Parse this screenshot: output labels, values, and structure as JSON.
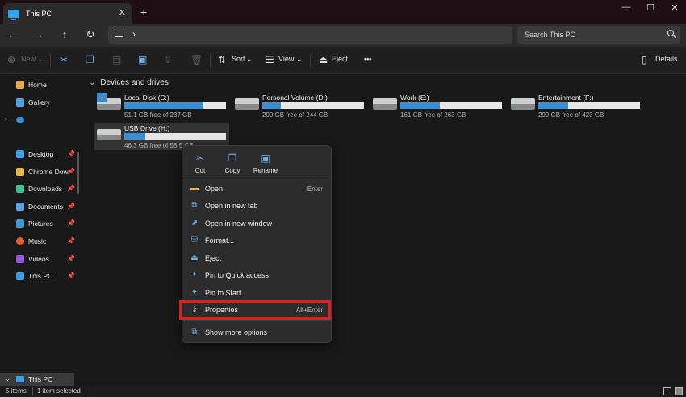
{
  "window": {
    "tab_title": "This PC",
    "new_tab": "+",
    "close_tab": "✕",
    "controls": {
      "minimize": "—",
      "maximize": "☐",
      "close": "✕"
    }
  },
  "address": {
    "search_placeholder": "Search This PC",
    "chevron": "›"
  },
  "nav": {
    "back": "←",
    "forward": "→",
    "up": "↑",
    "refresh": "↻"
  },
  "toolbar": {
    "new_label": "New",
    "sort_label": "Sort",
    "view_label": "View",
    "eject_label": "Eject",
    "more": "•••",
    "details_label": "Details"
  },
  "sidebar": {
    "items": [
      {
        "label": "Home",
        "icon": "home-icon",
        "color": "#e8a54a",
        "pinned": false
      },
      {
        "label": "Gallery",
        "icon": "gallery-icon",
        "color": "#4fa3e0",
        "pinned": false
      },
      {
        "label": "",
        "icon": "onedrive-icon",
        "color": "#3a8fd6",
        "pinned": false
      },
      {
        "label": "Desktop",
        "icon": "desktop-icon",
        "color": "#3aa0e6",
        "pinned": true
      },
      {
        "label": "Chrome Dow",
        "icon": "folder-icon",
        "color": "#e8b94a",
        "pinned": true
      },
      {
        "label": "Downloads",
        "icon": "download-icon",
        "color": "#3ac48a",
        "pinned": true
      },
      {
        "label": "Documents",
        "icon": "documents-icon",
        "color": "#5aa0e6",
        "pinned": true
      },
      {
        "label": "Pictures",
        "icon": "pictures-icon",
        "color": "#3a9ad6",
        "pinned": true
      },
      {
        "label": "Music",
        "icon": "music-icon",
        "color": "#e0603a",
        "pinned": true
      },
      {
        "label": "Videos",
        "icon": "videos-icon",
        "color": "#9a5ae0",
        "pinned": true
      },
      {
        "label": "This PC",
        "icon": "this-pc-icon",
        "color": "#3aa0e6",
        "pinned": true
      }
    ],
    "bottom_item": "This PC"
  },
  "main": {
    "section_title": "Devices and drives",
    "drives": [
      {
        "name": "Local Disk (C:)",
        "free_text": "51.1 GB free of 237 GB",
        "used_fraction": 0.78,
        "system": true,
        "selected": false
      },
      {
        "name": "Personal Volume (D:)",
        "free_text": "200 GB free of 244 GB",
        "used_fraction": 0.18,
        "system": false,
        "selected": false
      },
      {
        "name": "Work (E:)",
        "free_text": "161 GB free of 263 GB",
        "used_fraction": 0.39,
        "system": false,
        "selected": false
      },
      {
        "name": "Entertainment (F:)",
        "free_text": "299 GB free of 423 GB",
        "used_fraction": 0.29,
        "system": false,
        "selected": false
      },
      {
        "name": "USB Drive (H:)",
        "free_text": "46.3 GB free of 58.5 GB",
        "used_fraction": 0.21,
        "system": false,
        "selected": true
      }
    ]
  },
  "context_menu": {
    "quick_actions": [
      {
        "label": "Cut",
        "icon": "cut-icon",
        "glyph": "✂"
      },
      {
        "label": "Copy",
        "icon": "copy-icon",
        "glyph": "❐"
      },
      {
        "label": "Rename",
        "icon": "rename-icon",
        "glyph": "▣"
      }
    ],
    "items": [
      {
        "label": "Open",
        "shortcut": "Enter",
        "icon": "open-folder-icon",
        "glyph": "▬"
      },
      {
        "label": "Open in new tab",
        "shortcut": "",
        "icon": "new-tab-icon",
        "glyph": "⧉"
      },
      {
        "label": "Open in new window",
        "shortcut": "",
        "icon": "new-window-icon",
        "glyph": "⬈"
      },
      {
        "label": "Format...",
        "shortcut": "",
        "icon": "format-icon",
        "glyph": "⛁"
      },
      {
        "label": "Eject",
        "shortcut": "",
        "icon": "eject-icon",
        "glyph": "⏏"
      },
      {
        "label": "Pin to Quick access",
        "shortcut": "",
        "icon": "pin-icon",
        "glyph": "✦"
      },
      {
        "label": "Pin to Start",
        "shortcut": "",
        "icon": "pin-start-icon",
        "glyph": "✦"
      },
      {
        "label": "Properties",
        "shortcut": "Alt+Enter",
        "icon": "properties-icon",
        "glyph": "⚷"
      },
      {
        "label": "Show more options",
        "shortcut": "",
        "icon": "more-options-icon",
        "glyph": "⧉"
      }
    ]
  },
  "status": {
    "item_count": "5 items",
    "selection": "1 item selected"
  },
  "colors": {
    "accent": "#3a8fd6",
    "highlight_box": "#e01e1e"
  }
}
